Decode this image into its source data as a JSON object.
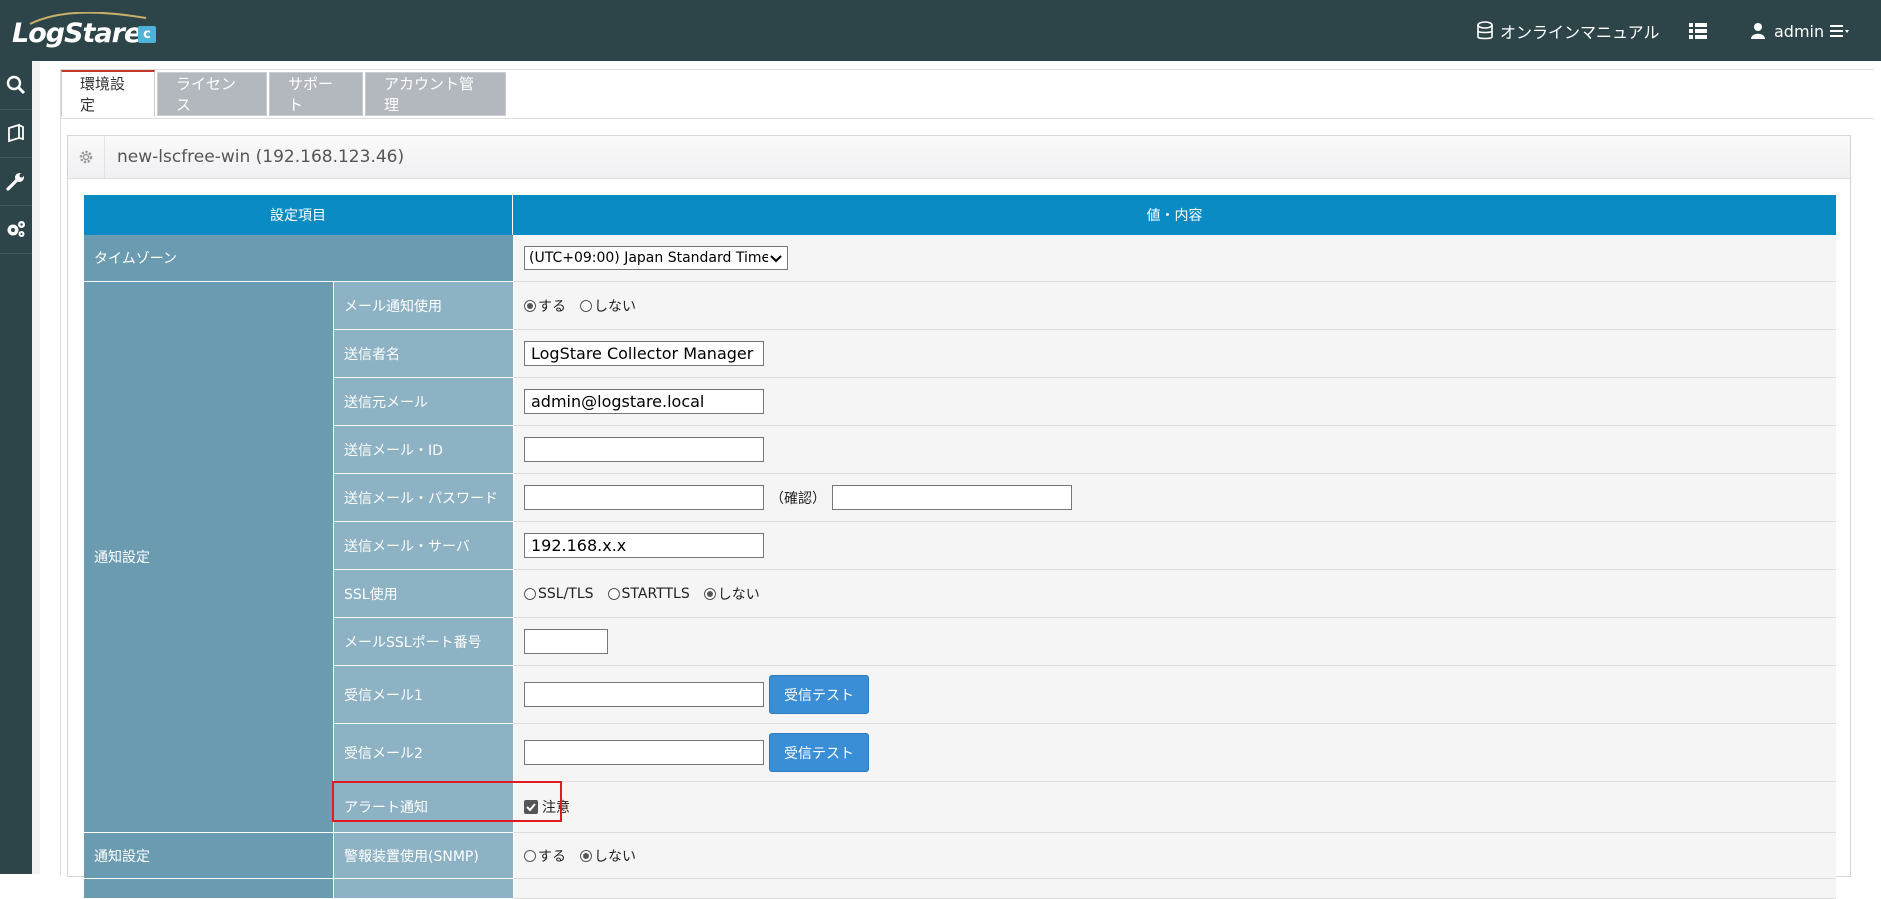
{
  "brand": {
    "logo_text": "LogStare",
    "logo_badge": "c"
  },
  "topnav": {
    "manual_label": "オンラインマニュアル",
    "user_label": "admin"
  },
  "tabs": [
    {
      "label": "環境設定"
    },
    {
      "label": "ライセンス"
    },
    {
      "label": "サポート"
    },
    {
      "label": "アカウント管理"
    }
  ],
  "panel": {
    "title": "new-lscfree-win (192.168.123.46)"
  },
  "table": {
    "headers": {
      "item": "設定項目",
      "value": "値・内容"
    },
    "timezone": {
      "label": "タイムゾーン",
      "selected": "(UTC+09:00) Japan Standard Time"
    },
    "notify_category": "通知設定",
    "mail_use": {
      "label": "メール通知使用",
      "options": [
        "する",
        "しない"
      ],
      "selected": "する"
    },
    "sender_name": {
      "label": "送信者名",
      "value": "LogStare Collector Manager"
    },
    "sender_mail": {
      "label": "送信元メール",
      "value": "admin@logstare.local"
    },
    "mail_id": {
      "label": "送信メール・ID",
      "value": ""
    },
    "mail_password": {
      "label": "送信メール・パスワード",
      "confirm_label": "（確認）",
      "value": "",
      "confirm_value": ""
    },
    "mail_server": {
      "label": "送信メール・サーバ",
      "value": "192.168.x.x"
    },
    "ssl_use": {
      "label": "SSL使用",
      "options": [
        "SSL/TLS",
        "STARTTLS",
        "しない"
      ],
      "selected": "しない"
    },
    "ssl_port": {
      "label": "メールSSLポート番号",
      "value": ""
    },
    "recv_mail1": {
      "label": "受信メール1",
      "value": "",
      "button": "受信テスト"
    },
    "recv_mail2": {
      "label": "受信メール2",
      "value": "",
      "button": "受信テスト"
    },
    "alert_notify": {
      "label": "アラート通知",
      "checkbox_label": "注意",
      "checked": true
    },
    "snmp": {
      "category": "通知設定",
      "label": "警報装置使用(SNMP)",
      "options": [
        "する",
        "しない"
      ],
      "selected": "しない"
    }
  }
}
